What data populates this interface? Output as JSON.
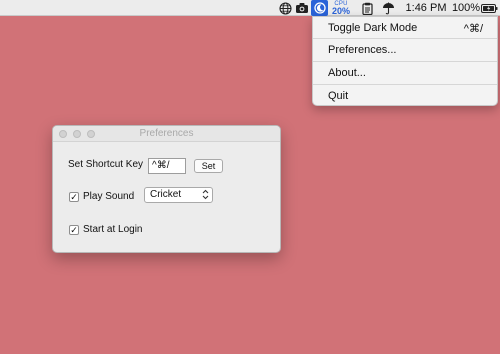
{
  "menubar": {
    "cpu_label": "CPU",
    "cpu_value": "20%",
    "time": "1:46 PM",
    "battery": "100%",
    "icons": [
      "globe-icon",
      "camera-icon",
      "dark-mode-moon-icon",
      "clipboard-icon",
      "umbrella-icon",
      "battery-icon"
    ]
  },
  "menu": {
    "items": [
      {
        "label": "Toggle Dark Mode",
        "shortcut": "^⌘/"
      },
      {
        "label": "Preferences..."
      },
      {
        "label": "About..."
      },
      {
        "label": "Quit"
      }
    ]
  },
  "preferences": {
    "title": "Preferences",
    "shortcut_label": "Set Shortcut Key",
    "shortcut_value": "^⌘/",
    "set_button": "Set",
    "play_sound_label": "Play Sound",
    "play_sound_checked": true,
    "sound_selected": "Cricket",
    "start_at_login_label": "Start at Login",
    "start_at_login_checked": true
  },
  "colors": {
    "desktop": "#d17277",
    "accent": "#2a63d8"
  }
}
